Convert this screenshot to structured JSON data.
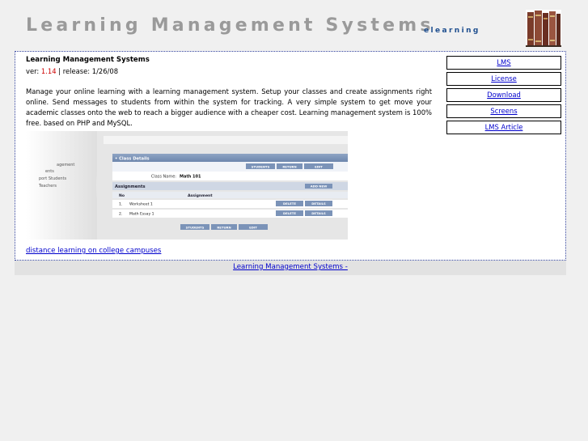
{
  "header": {
    "title": "Learning Management Systems",
    "tagline": "elearning",
    "books_icon": "books-icon"
  },
  "main": {
    "product_name": "Learning Management Systems",
    "version_prefix": "ver:",
    "version_number": "1.14",
    "release_text": "| release: 1/26/08",
    "description": "Manage your online learning with a learning management system. Setup your classes and create assignments right online. Send messages to students from within the system for tracking. A very simple system to get move your academic classes onto the web to reach a bigger audience with a cheaper cost. Learning management system is 100% free. based on PHP and MySQL.",
    "screenshot": {
      "sidebar_items": [
        "agement",
        "ents",
        "port Students",
        "Teachers"
      ],
      "panel_title": "• Class Details",
      "top_buttons": [
        "STUDENTS",
        "RETURN",
        "EDIT"
      ],
      "class_name_label": "Class Name:",
      "class_name_value": "Math 101",
      "assignments_title": "Assignments",
      "add_new_button": "ADD NEW",
      "columns": [
        "No",
        "Assignment"
      ],
      "rows": [
        {
          "no": "1.",
          "name": "Worksheet 1",
          "actions": [
            "DELETE",
            "DETAILS"
          ]
        },
        {
          "no": "2.",
          "name": "Math Essay 1",
          "actions": [
            "DELETE",
            "DETAILS"
          ]
        }
      ],
      "bottom_buttons": [
        "STUDENTS",
        "RETURN",
        "EDIT"
      ]
    },
    "bottom_link": "distance learning on college campuses"
  },
  "nav": {
    "items": [
      {
        "label": "LMS"
      },
      {
        "label": "License"
      },
      {
        "label": "Download"
      },
      {
        "label": "Screens"
      },
      {
        "label": "LMS Article"
      }
    ]
  },
  "footer": {
    "link": "Learning Management Systems -"
  },
  "colors": {
    "title": "#9a9a9a",
    "tagline": "#1f4f8f",
    "link": "#0000cc",
    "version": "#cc0000",
    "box_border": "#2e3f9a"
  }
}
